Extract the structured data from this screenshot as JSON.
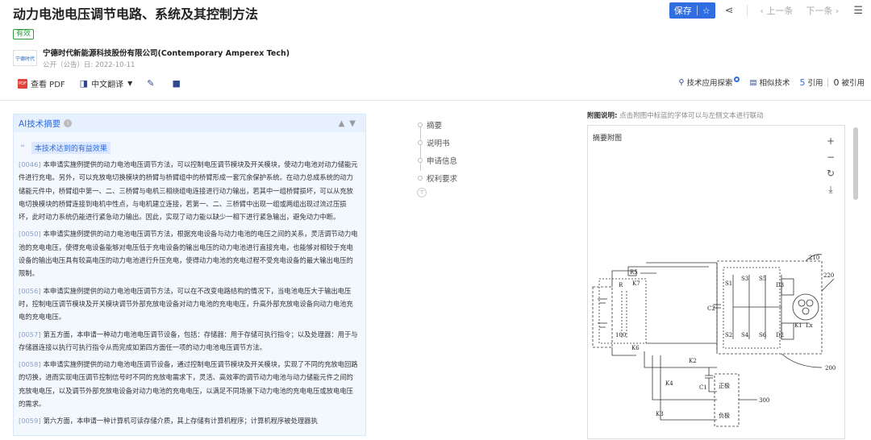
{
  "header": {
    "title": "动力电池电压调节电路、系统及其控制方法",
    "save_label": "保存",
    "prev_label": "上一条",
    "next_label": "下一条",
    "status_badge": "有效",
    "company": "宁德时代新能源科技股份有限公司(Contemporary Amperex Tech)",
    "pub_date": "公开（公告）日: 2022-10-11",
    "logo_text": "宁德时代"
  },
  "toolbar": {
    "pdf_label": "查看 PDF",
    "translate_label": "中文翻译",
    "tech_explore_label": "技术应用探索",
    "similar_label": "相似技术",
    "cite_count": "5",
    "cite_label": "引用",
    "cited_count": "0",
    "cited_label": "被引用"
  },
  "ai": {
    "title": "AI技术摘要",
    "subtitle": "本技术达到的有益效果",
    "paragraphs": [
      {
        "pn": "[0046]",
        "text": "本申请实施例提供的动力电池电压调节方法，可以控制电压调节模块及开关模块，使动力电池对动力储能元件进行充电。另外，可以充放电切换模块的桥臂与桥臂组中的桥臂形成一套冗余保护系统。在动力总成系统的动力储能元件中，桥臂组中第一、二、三桥臂与电机三相绕组电连接进行动力输出，若其中一组桥臂损坏，可以从充放电切换模块的桥臂连接到电机中性点，与电机建立连接，若第一、二、三桥臂中出现一组或两组出现过流过压损坏，此时动力系统仍能进行紧急动力输出。因此，实现了动力能以缺少一相下进行紧急输出，避免动力中断。"
      },
      {
        "pn": "[0050]",
        "text": "本申请实施例提供的动力电池电压调节方法，根据充电设备与动力电池的电压之间的关系，灵活调节动力电池的充电电压，使得充电设备能够对电压低于充电设备的输出电压的动力电池进行直接充电，也能够对相较于充电设备的输出电压具有较高电压的动力电池进行升压充电，使得动力电池的充电过程不受充电设备的最大输出电压的限制。"
      },
      {
        "pn": "[0056]",
        "text": "本申请实施例提供的动力电池电压调节方法，可以在不改变电路结构的情况下，当电池电压大于输出电压时，控制电压调节模块及开关模块调节外部充放电设备对动力电池的充电电压，升高外部充放电设备向动力电池充电的充电电压。"
      },
      {
        "pn": "[0057]",
        "text": "第五方面，本申请一种动力电池电压调节设备，包括：存储器：用于存储可执行指令；以及处理器：用于与存储器连接以执行可执行指令从而完成如第四方面任一项的动力电池电压调节方法。"
      },
      {
        "pn": "[0058]",
        "text": "本申请实施例提供的动力电池电压调节设备，通过控制电压调节模块及开关模块，实现了不同的充放电回路的切换，进而实现电压调节控制信号时不同的充放电需求下，灵活、高效率的调节动力电池与动力储能元件之间的充放电电压，以及调节外部充放电设备对动力电池的充电电压，以满足不同场景下动力电池的充电电压或放电电压的需求。"
      },
      {
        "pn": "[0059]",
        "text": "第六方面，本申请一种计算机可读存储介质，其上存储有计算机程序；计算机程序被处理器执"
      }
    ]
  },
  "toc": {
    "items": [
      "摘要",
      "说明书",
      "申请信息",
      "权利要求"
    ]
  },
  "figure": {
    "note_label": "附图说明:",
    "note_text": "点击附图中标蓝的字体可以与左侧文本进行联动",
    "title": "摘要附图",
    "labels": {
      "r5": "R5",
      "r": "R",
      "k7": "K7",
      "k6": "K6",
      "k2": "K2",
      "k4": "K4",
      "k3": "K3",
      "k1": "K1",
      "c2": "C2",
      "c1": "C1",
      "s1": "S1",
      "s2": "S2",
      "s3": "S3",
      "s4": "S4",
      "s5": "S5",
      "s6": "S6",
      "d3": "D3",
      "d2": "D2",
      "lx": "Lx",
      "n100": "100",
      "n200": "200",
      "n210": "210",
      "n220": "220",
      "n300": "300",
      "pos": "正极",
      "neg": "负极"
    }
  }
}
